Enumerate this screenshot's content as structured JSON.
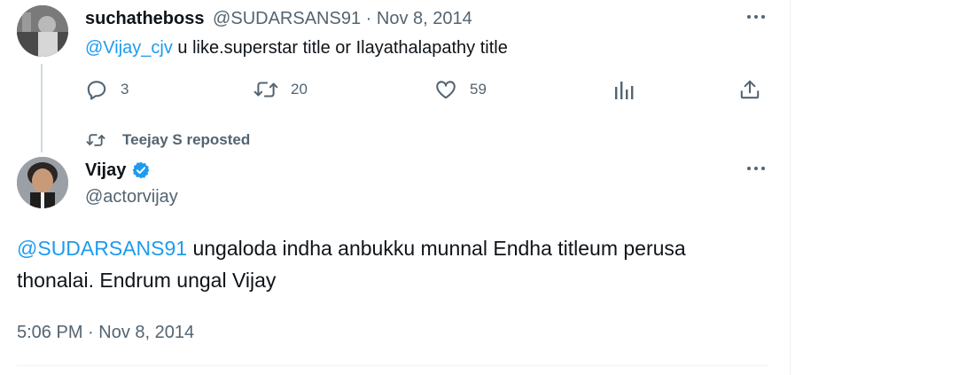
{
  "reply": {
    "display_name": "suchatheboss",
    "handle": "@SUDARSANS91",
    "separator": "·",
    "date": "Nov 8, 2014",
    "mention": "@Vijay_cjv",
    "text": " u like.superstar title or Ilayathalapathy title",
    "actions": {
      "replies": "3",
      "reposts": "20",
      "likes": "59"
    }
  },
  "repost_context": {
    "label": "Teejay S reposted"
  },
  "main_tweet": {
    "display_name": "Vijay",
    "verified": true,
    "handle": "@actorvijay",
    "mention": "@SUDARSANS91",
    "text_line1": " ungaloda indha anbukku munnal Endha titleum perusa",
    "text_line2": "thonalai. Endrum ungal Vijay",
    "timestamp": "5:06 PM · Nov 8, 2014"
  },
  "colors": {
    "link": "#1d9bf0",
    "muted": "#536471",
    "text": "#0f1419",
    "verified": "#1d9bf0"
  },
  "icons": [
    "reply-icon",
    "repost-icon",
    "like-icon",
    "analytics-icon",
    "share-icon",
    "more-icon",
    "verified-badge-icon"
  ]
}
